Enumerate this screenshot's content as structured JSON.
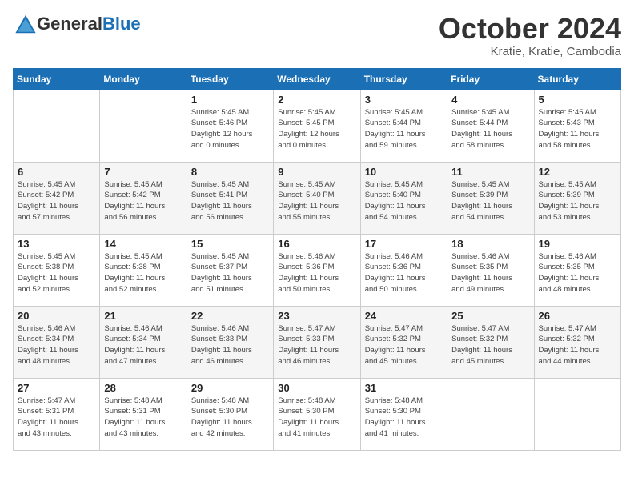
{
  "header": {
    "logo_general": "General",
    "logo_blue": "Blue",
    "month_title": "October 2024",
    "location": "Kratie, Kratie, Cambodia"
  },
  "weekdays": [
    "Sunday",
    "Monday",
    "Tuesday",
    "Wednesday",
    "Thursday",
    "Friday",
    "Saturday"
  ],
  "weeks": [
    [
      {
        "day": "",
        "info": ""
      },
      {
        "day": "",
        "info": ""
      },
      {
        "day": "1",
        "info": "Sunrise: 5:45 AM\nSunset: 5:46 PM\nDaylight: 12 hours\nand 0 minutes."
      },
      {
        "day": "2",
        "info": "Sunrise: 5:45 AM\nSunset: 5:45 PM\nDaylight: 12 hours\nand 0 minutes."
      },
      {
        "day": "3",
        "info": "Sunrise: 5:45 AM\nSunset: 5:44 PM\nDaylight: 11 hours\nand 59 minutes."
      },
      {
        "day": "4",
        "info": "Sunrise: 5:45 AM\nSunset: 5:44 PM\nDaylight: 11 hours\nand 58 minutes."
      },
      {
        "day": "5",
        "info": "Sunrise: 5:45 AM\nSunset: 5:43 PM\nDaylight: 11 hours\nand 58 minutes."
      }
    ],
    [
      {
        "day": "6",
        "info": "Sunrise: 5:45 AM\nSunset: 5:42 PM\nDaylight: 11 hours\nand 57 minutes."
      },
      {
        "day": "7",
        "info": "Sunrise: 5:45 AM\nSunset: 5:42 PM\nDaylight: 11 hours\nand 56 minutes."
      },
      {
        "day": "8",
        "info": "Sunrise: 5:45 AM\nSunset: 5:41 PM\nDaylight: 11 hours\nand 56 minutes."
      },
      {
        "day": "9",
        "info": "Sunrise: 5:45 AM\nSunset: 5:40 PM\nDaylight: 11 hours\nand 55 minutes."
      },
      {
        "day": "10",
        "info": "Sunrise: 5:45 AM\nSunset: 5:40 PM\nDaylight: 11 hours\nand 54 minutes."
      },
      {
        "day": "11",
        "info": "Sunrise: 5:45 AM\nSunset: 5:39 PM\nDaylight: 11 hours\nand 54 minutes."
      },
      {
        "day": "12",
        "info": "Sunrise: 5:45 AM\nSunset: 5:39 PM\nDaylight: 11 hours\nand 53 minutes."
      }
    ],
    [
      {
        "day": "13",
        "info": "Sunrise: 5:45 AM\nSunset: 5:38 PM\nDaylight: 11 hours\nand 52 minutes."
      },
      {
        "day": "14",
        "info": "Sunrise: 5:45 AM\nSunset: 5:38 PM\nDaylight: 11 hours\nand 52 minutes."
      },
      {
        "day": "15",
        "info": "Sunrise: 5:45 AM\nSunset: 5:37 PM\nDaylight: 11 hours\nand 51 minutes."
      },
      {
        "day": "16",
        "info": "Sunrise: 5:46 AM\nSunset: 5:36 PM\nDaylight: 11 hours\nand 50 minutes."
      },
      {
        "day": "17",
        "info": "Sunrise: 5:46 AM\nSunset: 5:36 PM\nDaylight: 11 hours\nand 50 minutes."
      },
      {
        "day": "18",
        "info": "Sunrise: 5:46 AM\nSunset: 5:35 PM\nDaylight: 11 hours\nand 49 minutes."
      },
      {
        "day": "19",
        "info": "Sunrise: 5:46 AM\nSunset: 5:35 PM\nDaylight: 11 hours\nand 48 minutes."
      }
    ],
    [
      {
        "day": "20",
        "info": "Sunrise: 5:46 AM\nSunset: 5:34 PM\nDaylight: 11 hours\nand 48 minutes."
      },
      {
        "day": "21",
        "info": "Sunrise: 5:46 AM\nSunset: 5:34 PM\nDaylight: 11 hours\nand 47 minutes."
      },
      {
        "day": "22",
        "info": "Sunrise: 5:46 AM\nSunset: 5:33 PM\nDaylight: 11 hours\nand 46 minutes."
      },
      {
        "day": "23",
        "info": "Sunrise: 5:47 AM\nSunset: 5:33 PM\nDaylight: 11 hours\nand 46 minutes."
      },
      {
        "day": "24",
        "info": "Sunrise: 5:47 AM\nSunset: 5:32 PM\nDaylight: 11 hours\nand 45 minutes."
      },
      {
        "day": "25",
        "info": "Sunrise: 5:47 AM\nSunset: 5:32 PM\nDaylight: 11 hours\nand 45 minutes."
      },
      {
        "day": "26",
        "info": "Sunrise: 5:47 AM\nSunset: 5:32 PM\nDaylight: 11 hours\nand 44 minutes."
      }
    ],
    [
      {
        "day": "27",
        "info": "Sunrise: 5:47 AM\nSunset: 5:31 PM\nDaylight: 11 hours\nand 43 minutes."
      },
      {
        "day": "28",
        "info": "Sunrise: 5:48 AM\nSunset: 5:31 PM\nDaylight: 11 hours\nand 43 minutes."
      },
      {
        "day": "29",
        "info": "Sunrise: 5:48 AM\nSunset: 5:30 PM\nDaylight: 11 hours\nand 42 minutes."
      },
      {
        "day": "30",
        "info": "Sunrise: 5:48 AM\nSunset: 5:30 PM\nDaylight: 11 hours\nand 41 minutes."
      },
      {
        "day": "31",
        "info": "Sunrise: 5:48 AM\nSunset: 5:30 PM\nDaylight: 11 hours\nand 41 minutes."
      },
      {
        "day": "",
        "info": ""
      },
      {
        "day": "",
        "info": ""
      }
    ]
  ]
}
